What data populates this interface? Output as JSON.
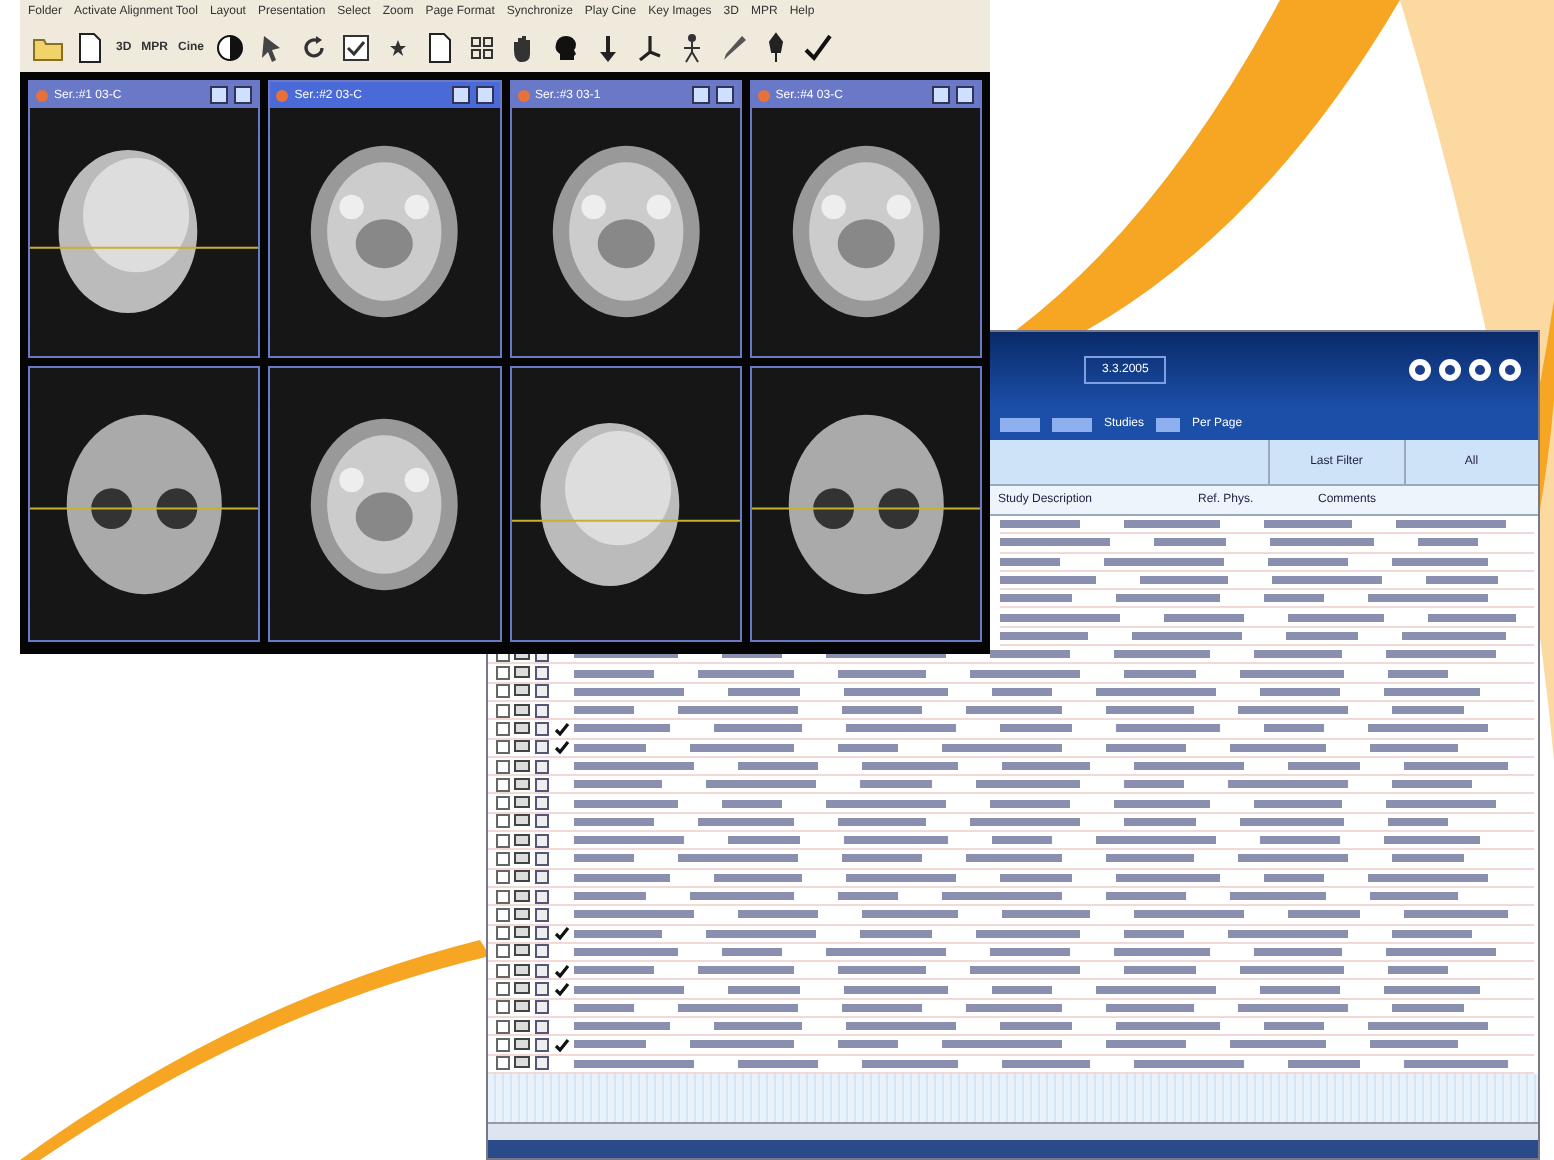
{
  "viewer": {
    "menu": [
      "Folder",
      "Activate Alignment Tool",
      "Layout",
      "Presentation",
      "Select",
      "Zoom",
      "Page Format",
      "Synchronize",
      "Play Cine",
      "Key Images",
      "3D",
      "MPR",
      "Help"
    ],
    "toolbar": [
      {
        "kind": "icon"
      },
      {
        "kind": "icon"
      },
      {
        "kind": "text",
        "label": "3D"
      },
      {
        "kind": "text",
        "label": "MPR"
      },
      {
        "kind": "text",
        "label": "Cine"
      },
      {
        "kind": "icon"
      },
      {
        "kind": "icon"
      },
      {
        "kind": "icon"
      },
      {
        "kind": "icon"
      },
      {
        "kind": "icon"
      },
      {
        "kind": "icon"
      },
      {
        "kind": "icon"
      },
      {
        "kind": "icon"
      },
      {
        "kind": "icon"
      },
      {
        "kind": "icon"
      },
      {
        "kind": "icon"
      },
      {
        "kind": "icon"
      },
      {
        "kind": "icon"
      },
      {
        "kind": "icon"
      },
      {
        "kind": "icon"
      }
    ],
    "panels": [
      {
        "title": "Ser.:#1  03-C",
        "selected": false
      },
      {
        "title": "Ser.:#2  03-C",
        "selected": true
      },
      {
        "title": "Ser.:#3  03-1",
        "selected": false
      },
      {
        "title": "Ser.:#4  03-C",
        "selected": false
      }
    ]
  },
  "worklist": {
    "date": "3.3.2005",
    "studies_label": "Studies",
    "per_page_label": "Per Page",
    "filters": [
      "Last Filter",
      "All"
    ],
    "columns": [
      "Study Description",
      "Ref. Phys.",
      "Comments"
    ],
    "rows": [
      {
        "kind": "covered"
      },
      {
        "kind": "covered"
      },
      {
        "kind": "covered"
      },
      {
        "kind": "covered"
      },
      {
        "kind": "covered"
      },
      {
        "kind": "covered"
      },
      {
        "kind": "covered"
      },
      {
        "kind": "full",
        "checked": false
      },
      {
        "kind": "full",
        "checked": false
      },
      {
        "kind": "full",
        "checked": false
      },
      {
        "kind": "full",
        "checked": false
      },
      {
        "kind": "full",
        "checked": true
      },
      {
        "kind": "full",
        "checked": true
      },
      {
        "kind": "full",
        "checked": false
      },
      {
        "kind": "full",
        "checked": false
      },
      {
        "kind": "full",
        "checked": false
      },
      {
        "kind": "full",
        "checked": false
      },
      {
        "kind": "full",
        "checked": false
      },
      {
        "kind": "full",
        "checked": false
      },
      {
        "kind": "full",
        "checked": false
      },
      {
        "kind": "full",
        "checked": false
      },
      {
        "kind": "full",
        "checked": false
      },
      {
        "kind": "full",
        "checked": true
      },
      {
        "kind": "full",
        "checked": false
      },
      {
        "kind": "full",
        "checked": true
      },
      {
        "kind": "full",
        "checked": true
      },
      {
        "kind": "full",
        "checked": false
      },
      {
        "kind": "full",
        "checked": false
      },
      {
        "kind": "full",
        "checked": true
      },
      {
        "kind": "full",
        "checked": false
      }
    ]
  }
}
